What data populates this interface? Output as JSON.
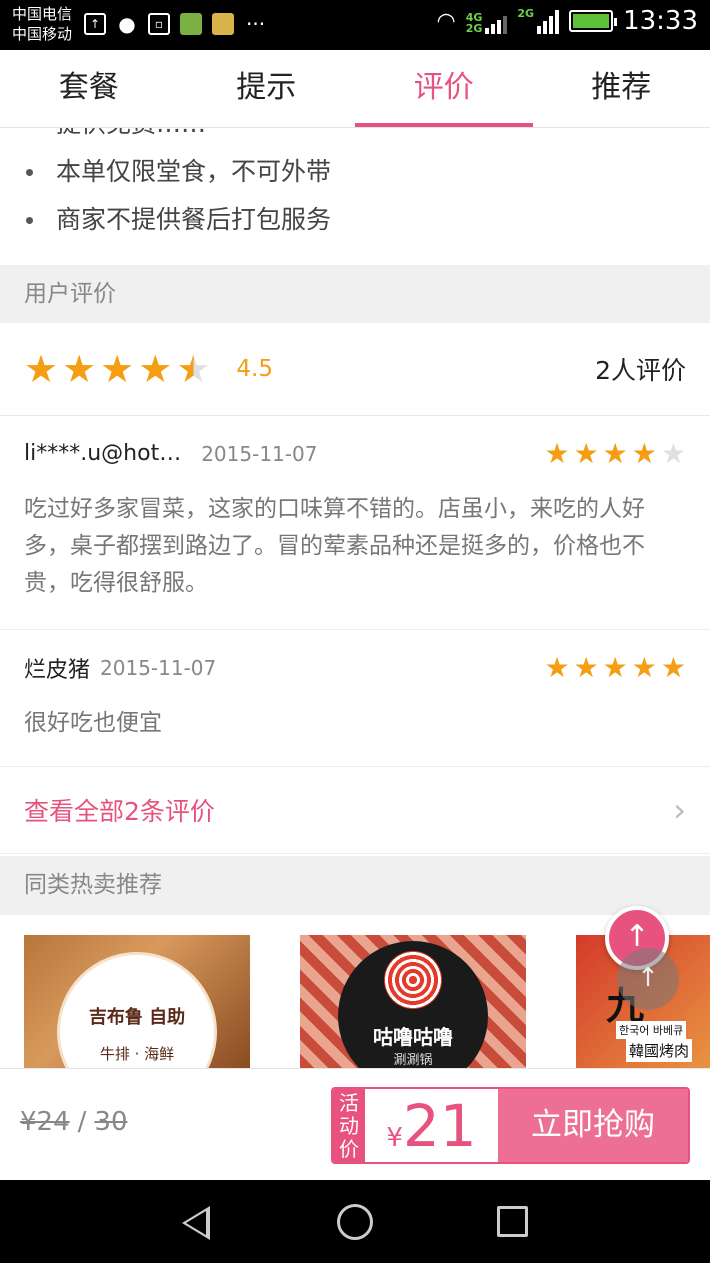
{
  "status_bar": {
    "carrier_1": "中国电信",
    "carrier_2": "中国移动",
    "net_1": "4G",
    "net_2": "2G",
    "net_3": "2G",
    "time": "13:33"
  },
  "tabs": [
    {
      "label": "套餐",
      "active": false
    },
    {
      "label": "提示",
      "active": false
    },
    {
      "label": "评价",
      "active": true
    },
    {
      "label": "推荐",
      "active": false
    }
  ],
  "tips": [
    "提供免费……",
    "本单仅限堂食，不可外带",
    "商家不提供餐后打包服务"
  ],
  "user_reviews": {
    "section_title": "用户评价",
    "average": "4.5",
    "average_stars": 4.5,
    "count_label": "2人评价",
    "reviews": [
      {
        "user": "li****.u@hot…",
        "date": "2015-11-07",
        "stars": 4,
        "text": "吃过好多家冒菜，这家的口味算不错的。店虽小，来吃的人好多，桌子都摆到路边了。冒的荤素品种还是挺多的，价格也不贵，吃得很舒服。"
      },
      {
        "user": "烂皮猪",
        "date": "2015-11-07",
        "stars": 5,
        "text": "很好吃也便宜"
      }
    ],
    "view_all": "查看全部2条评价"
  },
  "recommendations": {
    "section_title": "同类热卖推荐",
    "items": [
      {
        "name": "吉布鲁 自助",
        "subtitle": "牛排 · 海鲜"
      },
      {
        "name": "咕噜咕噜",
        "subtitle": "涮涮锅"
      },
      {
        "name": "九",
        "subtitle_ko": "한국어 바베큐",
        "subtitle": "韓國烤肉"
      }
    ]
  },
  "purchase_bar": {
    "discount_price": "¥24",
    "slash": "/",
    "original_price": "30",
    "promo_tag": "活动价",
    "currency": "¥",
    "promo_price": "21",
    "buy_label": "立即抢购"
  },
  "icons": {
    "star": "★",
    "chevron": "›",
    "up_arrow": "↑"
  },
  "colors": {
    "accent": "#e8527f",
    "star": "#f59d13"
  }
}
